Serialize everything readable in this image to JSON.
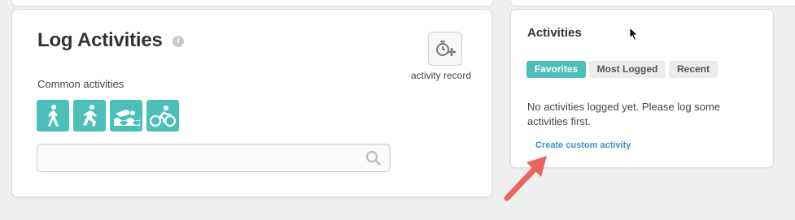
{
  "log_panel": {
    "title": "Log Activities",
    "info_glyph": "i",
    "record_label": "activity record",
    "common_label": "Common activities",
    "activity_icons": [
      "walking-icon",
      "running-icon",
      "swimming-icon",
      "cycling-icon"
    ],
    "search": {
      "placeholder": "",
      "value": ""
    }
  },
  "activities_panel": {
    "title": "Activities",
    "tabs": [
      {
        "label": "Favorites",
        "active": true
      },
      {
        "label": "Most Logged",
        "active": false
      },
      {
        "label": "Recent",
        "active": false
      }
    ],
    "empty_message": "No activities logged yet. Please log some activities first.",
    "custom_link": "Create custom activity"
  },
  "colors": {
    "accent": "#4cc0b8",
    "link": "#3d8fd6",
    "annotation_arrow": "#e8675a"
  }
}
